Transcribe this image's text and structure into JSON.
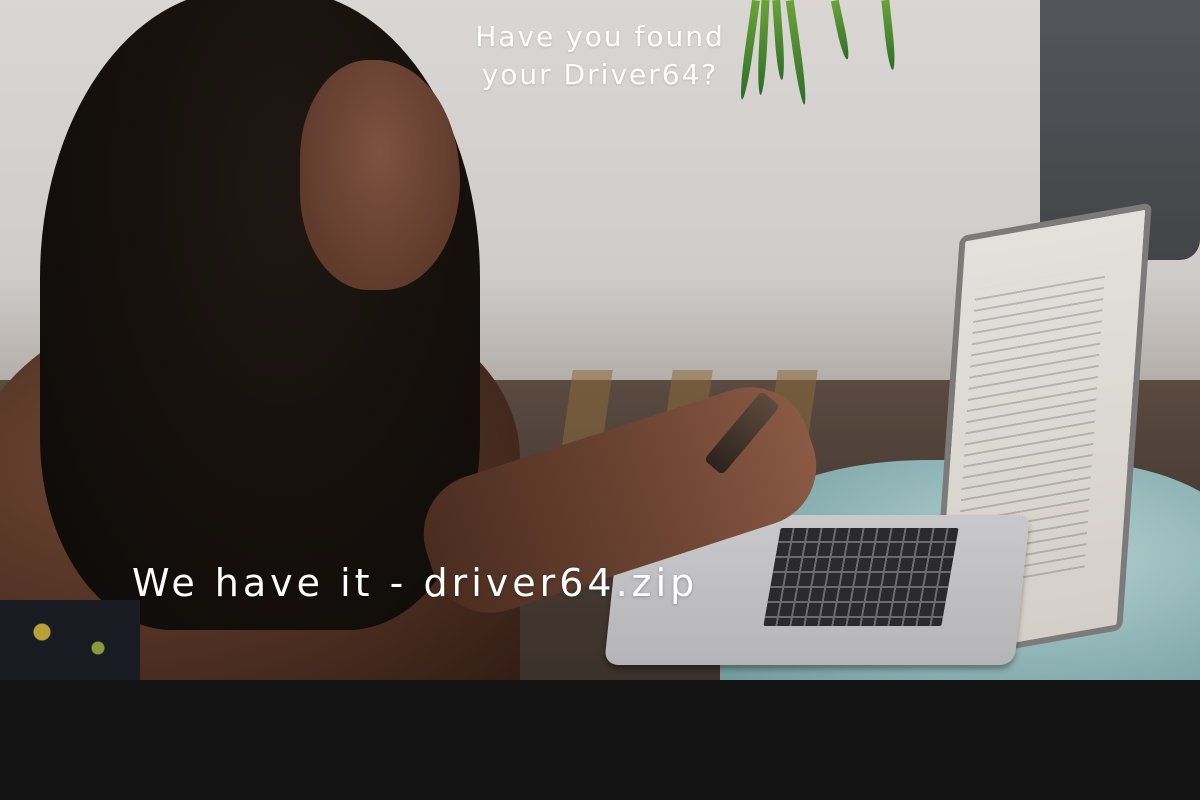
{
  "hero": {
    "title_line1": "Have you found",
    "title_line2": "your Driver64?",
    "tagline": "We have it - driver64.zip",
    "photo_subject": "woman-with-phone-and-laptop"
  },
  "colors": {
    "text": "#ffffff",
    "footer_background": "#141414"
  }
}
